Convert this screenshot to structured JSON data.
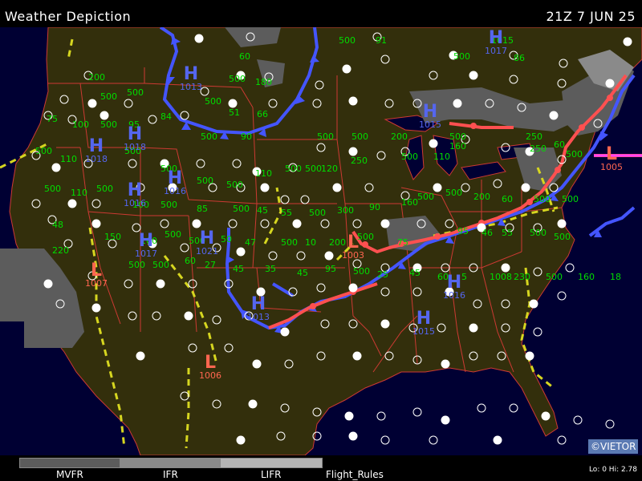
{
  "header": {
    "title": "Weather Depiction",
    "valid_time": "21Z  7 JUN 25"
  },
  "legend": {
    "items": [
      "MVFR",
      "IFR",
      "LIFR",
      "Flight_Rules"
    ],
    "colors": {
      "MVFR": "#5c5c5c",
      "IFR": "#8a8a8a",
      "LIFR": "#b4b4b4"
    }
  },
  "credit": "©VIETOR",
  "lohi": "Lo: 0 Hi: 2.78",
  "colors": {
    "land": "#332f0c",
    "ocean": "#000033",
    "borders": "#cc3a33",
    "high_pressure": "#5566ee",
    "low_pressure": "#ff6650",
    "cold_front": "#4455ff",
    "warm_front": "#ff5050",
    "ceiling_text": "#00dd00",
    "trough": "#d6d620"
  },
  "pressure_centers": [
    {
      "type": "H",
      "value": "1013"
    },
    {
      "type": "H",
      "value": "1018"
    },
    {
      "type": "H",
      "value": "1018"
    },
    {
      "type": "H",
      "value": "1016"
    },
    {
      "type": "H",
      "value": "1016"
    },
    {
      "type": "H",
      "value": "1017"
    },
    {
      "type": "H",
      "value": "1021"
    },
    {
      "type": "H",
      "value": "1013"
    },
    {
      "type": "H",
      "value": "1015"
    },
    {
      "type": "H",
      "value": "1017"
    },
    {
      "type": "H",
      "value": "1015"
    },
    {
      "type": "H",
      "value": "1016"
    },
    {
      "type": "L",
      "value": "1007"
    },
    {
      "type": "L",
      "value": "1006"
    },
    {
      "type": "L",
      "value": "1003"
    },
    {
      "type": "L",
      "value": "1005"
    }
  ],
  "ceiling_labels": [
    "500",
    "91",
    "500",
    "1015",
    "86",
    "200",
    "500",
    "500",
    "60",
    "500",
    "180",
    "500",
    "51",
    "66",
    "84",
    "75",
    "100",
    "500",
    "95",
    "500",
    "90",
    "500",
    "500",
    "200",
    "500",
    "250",
    "60",
    "500",
    "110",
    "500",
    "500",
    "500",
    "500",
    "110",
    "500",
    "500",
    "120",
    "250",
    "500",
    "110",
    "160",
    "250",
    "500",
    "500",
    "110",
    "500",
    "100",
    "500",
    "85",
    "500",
    "45",
    "55",
    "500",
    "300",
    "90",
    "160",
    "500",
    "500",
    "200",
    "60",
    "500",
    "500",
    "48",
    "150",
    "160",
    "500",
    "500",
    "50",
    "47",
    "500",
    "10",
    "200",
    "500",
    "75",
    "95",
    "46",
    "55",
    "500",
    "500",
    "220",
    "500",
    "500",
    "60",
    "27",
    "45",
    "35",
    "45",
    "95",
    "500",
    "25",
    "45",
    "60",
    "5",
    "1008",
    "230",
    "500",
    "160",
    "18",
    "500",
    "500",
    "500"
  ]
}
